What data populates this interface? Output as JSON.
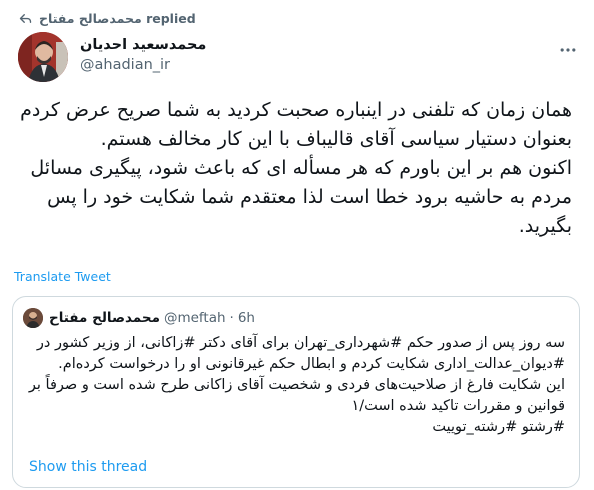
{
  "replied_banner": {
    "icon": "reply-arrow-icon",
    "text": "محمدصالح مفتاح replied"
  },
  "tweet": {
    "author_name": "محمدسعید احدیان",
    "handle": "@ahadian_ir",
    "more_icon": "more-options-icon",
    "text": "همان زمان که تلفنی در اینباره صحبت کردید به شما صریح عرض کردم بعنوان دستیار سیاسی آقای قالیباف با این کار مخالف هستم.\nاکنون هم بر این باورم که هر مسأله ای که باعث شود، پیگیری مسائل مردم به حاشیه برود خطا است لذا معتقدم شما شکایت خود را پس بگیرید.",
    "translate_label": "Translate Tweet"
  },
  "quoted_tweet": {
    "author_name": "محمدصالح مفتاح",
    "handle": "@meftah",
    "separator": "·",
    "time": "6h",
    "text": "سه روز پس از صدور حکم #شهرداری_تهران برای آقای دکتر #زاکانی، از وزیر کشور در #دیوان_عدالت_اداری شکایت کردم و ابطال حکم غیرقانونی او را درخواست کرده‌ام.\nاین شکایت فارغ از صلاحیت‌های فردی و شخصیت آقای زاکانی طرح شده است و صرفاً بر قوانین و مقررات تاکید شده است/۱\n#رشتو #رشته_توییت",
    "show_thread_label": "Show this thread"
  },
  "colors": {
    "link": "#1d9bf0",
    "secondary_text": "#536471",
    "border": "#cfd9de"
  }
}
